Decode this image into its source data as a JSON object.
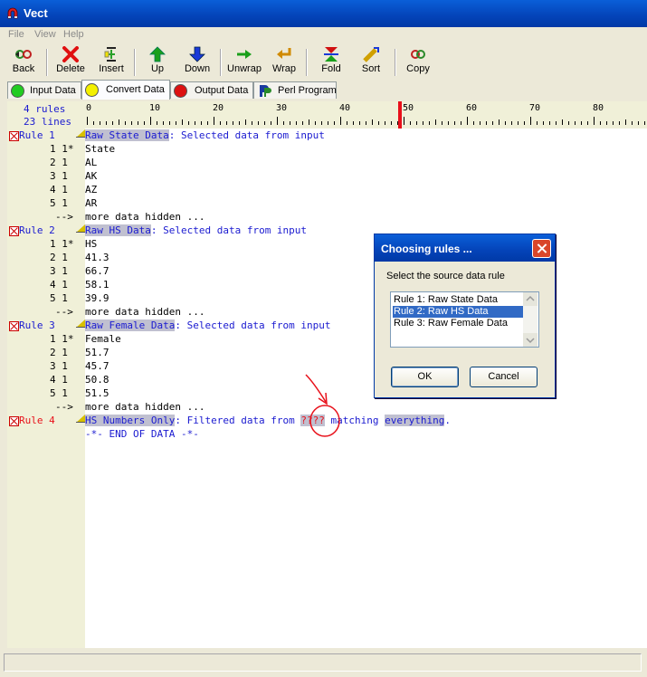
{
  "window": {
    "title": "Vect"
  },
  "menu": [
    "File",
    "View",
    "Help"
  ],
  "toolbar": [
    {
      "label": "Back",
      "icon": "back-icon"
    },
    {
      "label": "Delete",
      "icon": "delete-icon"
    },
    {
      "label": "Insert",
      "icon": "insert-icon"
    },
    {
      "label": "Up",
      "icon": "up-arrow-icon"
    },
    {
      "label": "Down",
      "icon": "down-arrow-icon"
    },
    {
      "label": "Unwrap",
      "icon": "unwrap-icon"
    },
    {
      "label": "Wrap",
      "icon": "wrap-icon"
    },
    {
      "label": "Fold",
      "icon": "fold-icon"
    },
    {
      "label": "Sort",
      "icon": "sort-icon"
    },
    {
      "label": "Copy",
      "icon": "copy-icon"
    }
  ],
  "tabs": [
    {
      "label": "Input Data",
      "color": "#22cc22"
    },
    {
      "label": "Convert Data",
      "color": "#f4f000",
      "active": true
    },
    {
      "label": "Output Data",
      "color": "#dd1111"
    },
    {
      "label": "Perl Program",
      "color": "#1a3aa0"
    }
  ],
  "summary": {
    "rules": "4 rules",
    "lines": "23 lines"
  },
  "ruler_labels": [
    "0",
    "10",
    "20",
    "30",
    "40",
    "50",
    "60",
    "70",
    "80"
  ],
  "rules": [
    {
      "label": "Rule 1",
      "name": "Raw State Data",
      "desc": ": Selected data from input",
      "lines": [
        [
          "1 1*",
          "State"
        ],
        [
          "2 1",
          "AL"
        ],
        [
          "3 1",
          "AK"
        ],
        [
          "4 1",
          "AZ"
        ],
        [
          "5 1",
          "AR"
        ]
      ],
      "more": [
        "-->",
        "more data hidden ..."
      ]
    },
    {
      "label": "Rule 2",
      "name": "Raw HS Data",
      "desc": ": Selected data from input",
      "lines": [
        [
          "1 1*",
          "HS"
        ],
        [
          "2 1",
          "41.3"
        ],
        [
          "3 1",
          "66.7"
        ],
        [
          "4 1",
          "58.1"
        ],
        [
          "5 1",
          "39.9"
        ]
      ],
      "more": [
        "-->",
        "more data hidden ..."
      ]
    },
    {
      "label": "Rule 3",
      "name": "Raw Female Data",
      "desc": ": Selected data from input",
      "lines": [
        [
          "1 1*",
          "Female"
        ],
        [
          "2 1",
          "51.7"
        ],
        [
          "3 1",
          "45.7"
        ],
        [
          "4 1",
          "50.8"
        ],
        [
          "5 1",
          "51.5"
        ]
      ],
      "more": [
        "-->",
        "more data hidden ..."
      ]
    }
  ],
  "rule4": {
    "label": "Rule 4",
    "name": "HS Numbers Only",
    "desc_a": ": Filtered data from ",
    "placeholder": "????",
    "desc_b": " matching ",
    "match": "everything",
    "end": "."
  },
  "end_of_data": "-*- END OF DATA -*-",
  "dialog": {
    "title": "Choosing rules ...",
    "prompt": "Select the source data rule",
    "options": [
      "Rule 1: Raw State Data",
      "Rule 2: Raw HS Data",
      "Rule 3: Raw Female Data"
    ],
    "selected": "Rule 2: Raw HS Data",
    "ok": "OK",
    "cancel": "Cancel"
  }
}
